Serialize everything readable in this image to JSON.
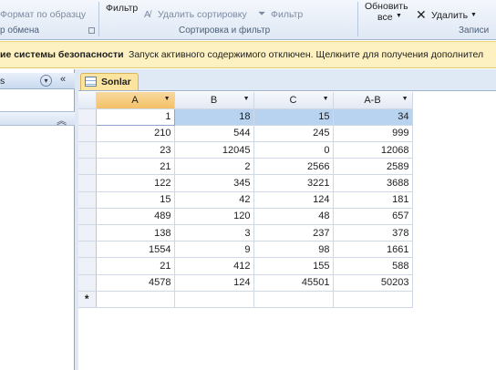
{
  "ribbon": {
    "format_painter": "Формат по образцу",
    "filter": "Фильтр",
    "remove_sort": "Удалить сортировку",
    "filter2": "Фильтр",
    "refresh_line1": "Обновить",
    "refresh_line2": "все",
    "delete": "Удалить",
    "clipboard_group": "р обмена",
    "sort_filter_group": "Сортировка и фильтр",
    "records_group": "Записи"
  },
  "security_bar": {
    "title": "ие системы безопасности",
    "message": "Запуск активного содержимого отключен. Щелкните для получения дополнител"
  },
  "nav": {
    "header": "s"
  },
  "tab": {
    "label": "Sonlar"
  },
  "table": {
    "columns": [
      "A",
      "B",
      "C",
      "A-B"
    ],
    "rows": [
      [
        "1",
        "18",
        "15",
        "34"
      ],
      [
        "210",
        "544",
        "245",
        "999"
      ],
      [
        "23",
        "12045",
        "0",
        "12068"
      ],
      [
        "21",
        "2",
        "2566",
        "2589"
      ],
      [
        "122",
        "345",
        "3221",
        "3688"
      ],
      [
        "15",
        "42",
        "124",
        "181"
      ],
      [
        "489",
        "120",
        "48",
        "657"
      ],
      [
        "138",
        "3",
        "237",
        "378"
      ],
      [
        "1554",
        "9",
        "98",
        "1661"
      ],
      [
        "21",
        "412",
        "155",
        "588"
      ],
      [
        "4578",
        "124",
        "45501",
        "50203"
      ]
    ],
    "new_row_marker": "*"
  }
}
